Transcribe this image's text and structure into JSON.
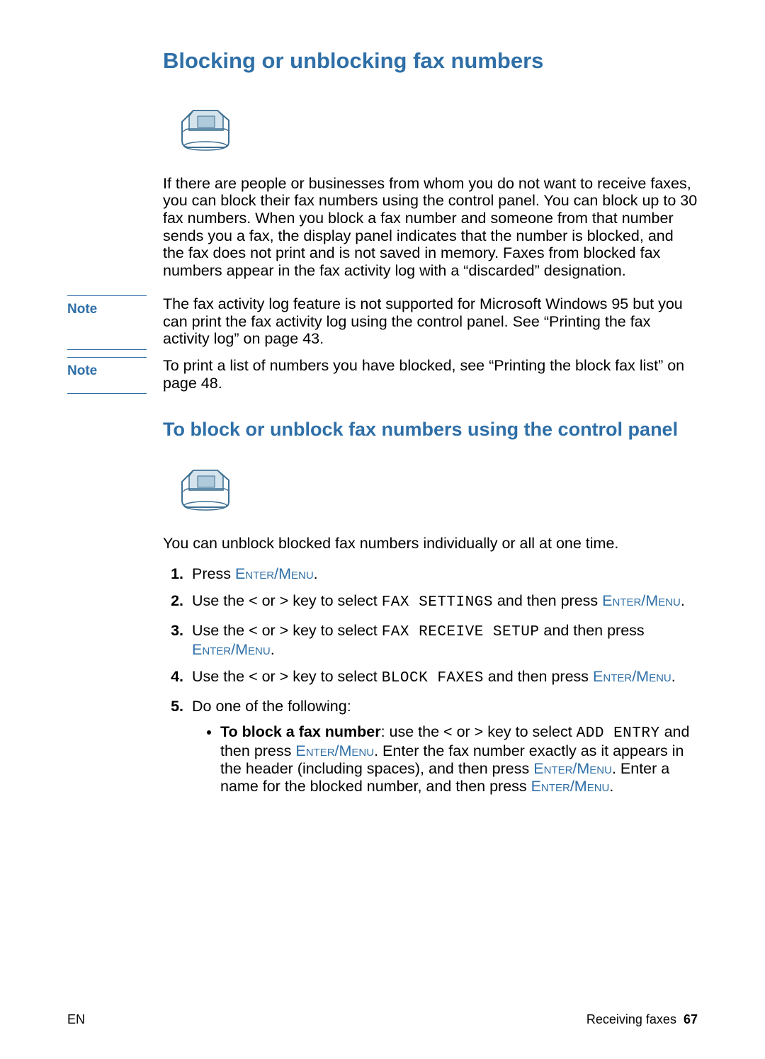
{
  "heading": "Blocking or unblocking fax numbers",
  "intro_paragraph": "If there are people or businesses from whom you do not want to receive faxes, you can block their fax numbers using the control panel. You can block up to 30 fax numbers. When you block a fax number and someone from that number sends you a fax, the display panel indicates that the number is blocked, and the fax does not print and is not saved in memory. Faxes from blocked fax numbers appear in the fax activity log with a “discarded” designation.",
  "note_label": "Note",
  "note1": "The fax activity log feature is not supported for Microsoft Windows 95 but you can print the fax activity log using the control panel. See “Printing the fax activity log” on page 43.",
  "note2": "To print a list of numbers you have blocked, see “Printing the block fax list” on page 48.",
  "subheading": "To block or unblock fax numbers using the control panel",
  "sub_intro": "You can unblock blocked fax numbers individually or all at one time.",
  "buttons": {
    "enter_menu": "Enter/Menu"
  },
  "lcd": {
    "fax_settings": "FAX SETTINGS",
    "fax_receive_setup": "FAX RECEIVE SETUP",
    "block_faxes": "BLOCK FAXES",
    "add_entry": "ADD ENTRY"
  },
  "steps": {
    "s1_prefix": "Press ",
    "s1_suffix": ".",
    "s2_a": "Use the < or > key to select ",
    "s2_b": " and then press ",
    "s2_c": ".",
    "s3_a": "Use the < or > key to select ",
    "s3_b": " and then press ",
    "s3_c": ".",
    "s4_a": "Use the < or > key to select ",
    "s4_b": " and then press ",
    "s4_c": ".",
    "s5": "Do one of the following:",
    "bullet1_bold": "To block a fax number",
    "bullet1_a": ": use the < or > key to select ",
    "bullet1_b": " and then press ",
    "bullet1_c": ". Enter the fax number exactly as it appears in the header (including spaces), and then press ",
    "bullet1_d": ". Enter a name for the blocked number, and then press ",
    "bullet1_e": "."
  },
  "footer": {
    "left": "EN",
    "section": "Receiving faxes",
    "page": "67"
  }
}
